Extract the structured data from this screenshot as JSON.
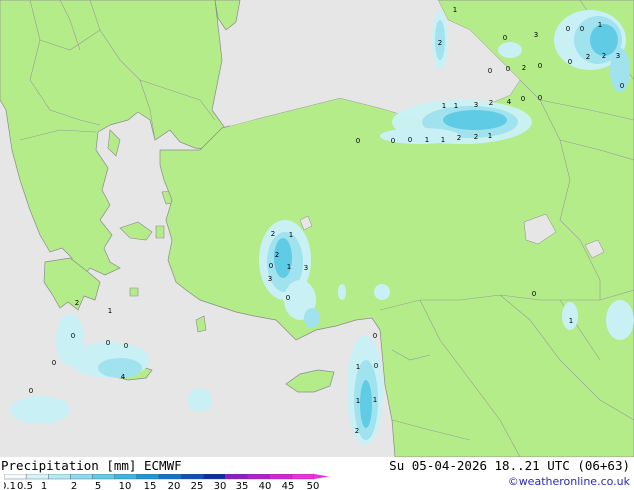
{
  "colors": {
    "land": "#b5ec8a",
    "sea": "#e6e6e6",
    "border": "#9a9a9a",
    "coast": "#8a8a8a",
    "precip_light": "#c9f1f5",
    "precip_mid": "#a0e2ee",
    "precip_strong": "#5fcbe5",
    "precip_heavy": "#3daee0",
    "credit_text": "#2a2ab5"
  },
  "footer": {
    "title": "Precipitation [mm]  ECMWF",
    "validity": "Su 05-04-2026 18..21 UTC (06+63)",
    "credit": "©weatheronline.co.uk"
  },
  "legend": {
    "ticks": [
      "0.1",
      "0.5",
      "1",
      "2",
      "5",
      "10",
      "15",
      "20",
      "25",
      "30",
      "35",
      "40",
      "45",
      "50"
    ],
    "colors": [
      "#f5fcff",
      "#d6f3fb",
      "#b4e9f6",
      "#8cdcf1",
      "#5fcbe9",
      "#3bb5e1",
      "#1f96d8",
      "#1473c8",
      "#0f4fb6",
      "#0b2fa0",
      "#8d1cc4",
      "#b31fd0",
      "#d225d8",
      "#ee2ee0"
    ]
  },
  "map_labels": [
    {
      "text": "1"
    },
    {
      "text": "2"
    },
    {
      "text": "0"
    },
    {
      "text": "3"
    },
    {
      "text": "0"
    },
    {
      "text": "0"
    },
    {
      "text": "1"
    },
    {
      "text": "0"
    },
    {
      "text": "0"
    },
    {
      "text": "2"
    },
    {
      "text": "2"
    },
    {
      "text": "2"
    },
    {
      "text": "3"
    },
    {
      "text": "0"
    },
    {
      "text": "0"
    },
    {
      "text": "0"
    },
    {
      "text": "0"
    },
    {
      "text": "1"
    },
    {
      "text": "1"
    },
    {
      "text": "3"
    },
    {
      "text": "2"
    },
    {
      "text": "4"
    },
    {
      "text": "0"
    },
    {
      "text": "0"
    },
    {
      "text": "0"
    },
    {
      "text": "0"
    },
    {
      "text": "1"
    },
    {
      "text": "1"
    },
    {
      "text": "2"
    },
    {
      "text": "2"
    },
    {
      "text": "2"
    },
    {
      "text": "1"
    },
    {
      "text": "2"
    },
    {
      "text": "1"
    },
    {
      "text": "3"
    },
    {
      "text": "0"
    },
    {
      "text": "3"
    },
    {
      "text": "0"
    },
    {
      "text": "2"
    },
    {
      "text": "0"
    },
    {
      "text": "1"
    },
    {
      "text": "0"
    },
    {
      "text": "0"
    },
    {
      "text": "0"
    },
    {
      "text": "4"
    },
    {
      "text": "0"
    },
    {
      "text": "0"
    },
    {
      "text": "1"
    },
    {
      "text": "0"
    },
    {
      "text": "1"
    },
    {
      "text": "1"
    },
    {
      "text": "1"
    },
    {
      "text": "2"
    },
    {
      "text": "0"
    },
    {
      "text": "1"
    }
  ]
}
